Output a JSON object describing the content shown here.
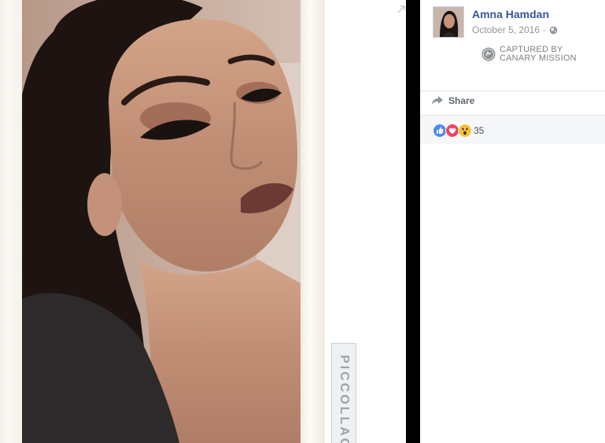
{
  "viewer": {
    "photo_alt": "selfie photo",
    "brand_watermark": "PICCOLLAGE",
    "expand_icon": "expand-icon"
  },
  "post": {
    "author_name": "Amna Hamdan",
    "date": "October 5, 2016",
    "separator": "·",
    "privacy_icon": "globe-icon"
  },
  "watermark": {
    "line1": "CAPTURED BY",
    "line2": "CANARY MISSION"
  },
  "actions": {
    "share_label": "Share"
  },
  "reactions": {
    "types": [
      "like",
      "love",
      "wow"
    ],
    "count": "35",
    "colors": {
      "like": "#4e86f7",
      "love": "#f3425f",
      "wow": "#f7c33b"
    }
  },
  "colors": {
    "link": "#365899",
    "meta": "#90949c",
    "black_bar": "#000000"
  }
}
